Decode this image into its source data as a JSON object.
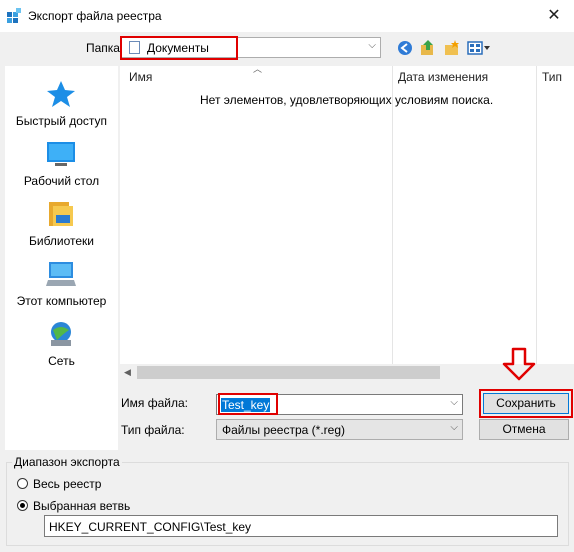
{
  "window": {
    "title": "Экспорт файла реестра",
    "close_glyph": "✕"
  },
  "folder": {
    "label": "Папка:",
    "value": "Документы"
  },
  "places": [
    {
      "label": "Быстрый доступ",
      "icon": "star-icon"
    },
    {
      "label": "Рабочий стол",
      "icon": "desktop-icon"
    },
    {
      "label": "Библиотеки",
      "icon": "libraries-icon"
    },
    {
      "label": "Этот компьютер",
      "icon": "computer-icon"
    },
    {
      "label": "Сеть",
      "icon": "network-icon"
    }
  ],
  "filelist": {
    "columns": [
      "Имя",
      "Дата изменения",
      "Тип"
    ],
    "empty_message": "Нет элементов, удовлетворяющих условиям поиска."
  },
  "filename": {
    "label": "Имя файла:",
    "value": "Test_key"
  },
  "filetype": {
    "label": "Тип файла:",
    "value": "Файлы реестра (*.reg)"
  },
  "buttons": {
    "save": "Сохранить",
    "cancel": "Отмена"
  },
  "export_range": {
    "title": "Диапазон экспорта",
    "options": [
      "Весь реестр",
      "Выбранная ветвь"
    ],
    "selected_option": "Выбранная ветвь",
    "branch_value": "HKEY_CURRENT_CONFIG\\Test_key"
  },
  "colors": {
    "annotation_red": "#e00000",
    "accent_blue": "#0078d7"
  }
}
